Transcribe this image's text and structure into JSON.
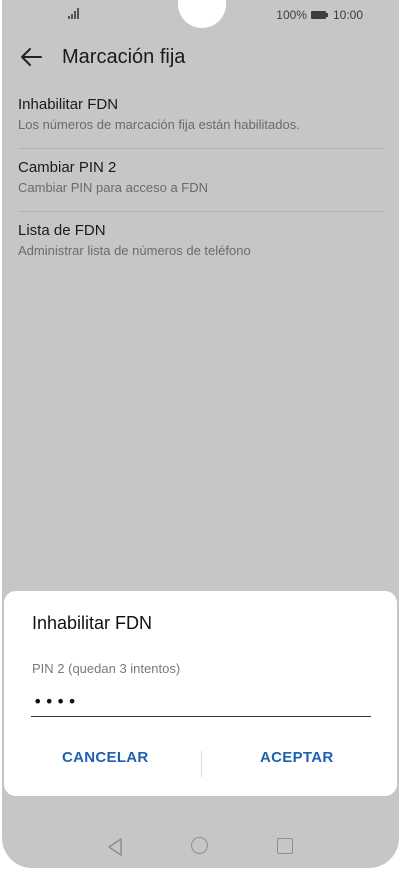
{
  "status": {
    "battery_text": "100%",
    "time": "10:00",
    "battery_level": 100
  },
  "header": {
    "title": "Marcación fija"
  },
  "settings": [
    {
      "title": "Inhabilitar FDN",
      "subtitle": "Los números de marcación fija están habilitados."
    },
    {
      "title": "Cambiar PIN 2",
      "subtitle": "Cambiar PIN para acceso a FDN"
    },
    {
      "title": "Lista de FDN",
      "subtitle": "Administrar lista de números de teléfono"
    }
  ],
  "dialog": {
    "title": "Inhabilitar FDN",
    "field_label": "PIN 2 (quedan 3 intentos)",
    "field_value": "••••",
    "cancel_label": "CANCELAR",
    "accept_label": "ACEPTAR"
  },
  "colors": {
    "dim_background": "#c6c6c6",
    "accent": "#1f61b0"
  },
  "icons": {
    "back": "arrow-left",
    "nav_back": "triangle-left",
    "nav_home": "circle",
    "nav_recents": "square",
    "signal": "signal-bars",
    "battery": "battery-full"
  }
}
